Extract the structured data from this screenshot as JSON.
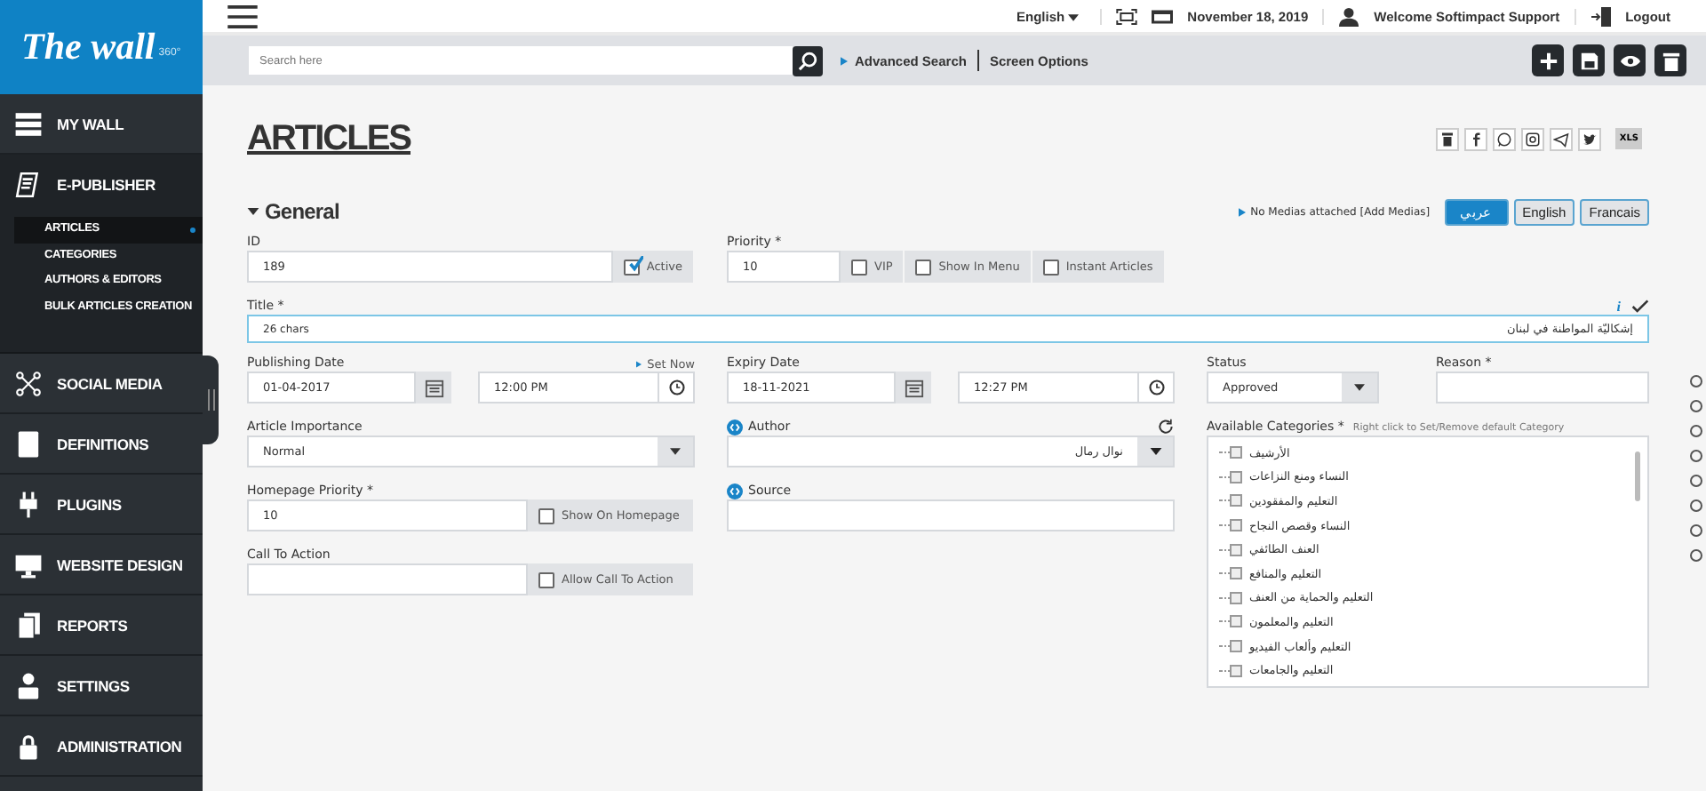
{
  "sidebar": {
    "logo": {
      "text": "The wall",
      "sup": "360°"
    },
    "items": [
      {
        "label": "MY WALL",
        "selected": false
      },
      {
        "label": "E-PUBLISHER",
        "selected": true,
        "children": [
          {
            "label": "ARTICLES",
            "selected": true
          },
          {
            "label": "CATEGORIES",
            "selected": false
          },
          {
            "label": "AUTHORS & EDITORS",
            "selected": false
          },
          {
            "label": "BULK ARTICLES CREATION",
            "selected": false
          }
        ]
      },
      {
        "label": "SOCIAL MEDIA",
        "selected": false
      },
      {
        "label": "DEFINITIONS",
        "selected": false
      },
      {
        "label": "PLUGINS",
        "selected": false
      },
      {
        "label": "WEBSITE DESIGN",
        "selected": false
      },
      {
        "label": "REPORTS",
        "selected": false
      },
      {
        "label": "SETTINGS",
        "selected": false
      },
      {
        "label": "ADMINISTRATION",
        "selected": false
      }
    ]
  },
  "topbar": {
    "language": "English",
    "date": "November 18, 2019",
    "welcome": "Welcome Softimpact Support",
    "logout": "Logout"
  },
  "toolbar": {
    "search": {
      "placeholder": "Search here"
    },
    "links": [
      "Advanced Search",
      "Screen Options"
    ]
  },
  "page_title": "ARTICLES",
  "export_label": "XLS",
  "section": {
    "title": "General",
    "media_note": "No Medias attached [Add Medias]",
    "languages": [
      {
        "label": "عربي",
        "selected": true
      },
      {
        "label": "English",
        "selected": false
      },
      {
        "label": "Francais",
        "selected": false
      }
    ]
  },
  "form": {
    "id": {
      "label": "ID",
      "value": "189",
      "active": {
        "label": "Active",
        "checked": true
      }
    },
    "priority": {
      "label": "Priority *",
      "value": "10",
      "options": [
        {
          "label": "VIP",
          "checked": false
        },
        {
          "label": "Show In Menu",
          "checked": false
        },
        {
          "label": "Instant Articles",
          "checked": false
        }
      ]
    },
    "title": {
      "label": "Title *",
      "info": "i",
      "counter": "26 chars",
      "value": "إشكاليّة المواطنة في لبنان"
    },
    "publishing": {
      "label": "Publishing Date",
      "set_now": "Set Now",
      "date": "01-04-2017",
      "time": "12:00 PM"
    },
    "expiry": {
      "label": "Expiry Date",
      "date": "18-11-2021",
      "time": "12:27 PM"
    },
    "status": {
      "label": "Status",
      "value": "Approved"
    },
    "reason": {
      "label": "Reason *"
    },
    "importance": {
      "label": "Article Importance",
      "value": "Normal"
    },
    "homepage_priority": {
      "label": "Homepage Priority *",
      "value": "10",
      "option": {
        "label": "Show On Homepage",
        "checked": false
      }
    },
    "call_to_action": {
      "label": "Call To Action",
      "option": {
        "label": "Allow Call To Action",
        "checked": false
      }
    },
    "author": {
      "label": "Author",
      "value": "نوال رمال"
    },
    "source": {
      "label": "Source"
    },
    "categories": {
      "label": "Available Categories *",
      "hint": "Right click to Set/Remove default Category",
      "items": [
        {
          "label": "الأرشيف",
          "checked": false
        },
        {
          "label": "النساء ومنع النزاعات",
          "checked": false
        },
        {
          "label": "التعليم والمفقودين",
          "checked": false
        },
        {
          "label": "النساء وقصص النجاح",
          "checked": false
        },
        {
          "label": "العنف الطائفي",
          "checked": false
        },
        {
          "label": "التعليم والمنافع",
          "checked": false
        },
        {
          "label": "التعليم والحماية من العنف",
          "checked": false
        },
        {
          "label": "التعليم والمعلمون",
          "checked": false
        },
        {
          "label": "التعليم وألعاب الفيديو",
          "checked": false
        },
        {
          "label": "التعليم والجامعات",
          "checked": false
        }
      ]
    }
  }
}
